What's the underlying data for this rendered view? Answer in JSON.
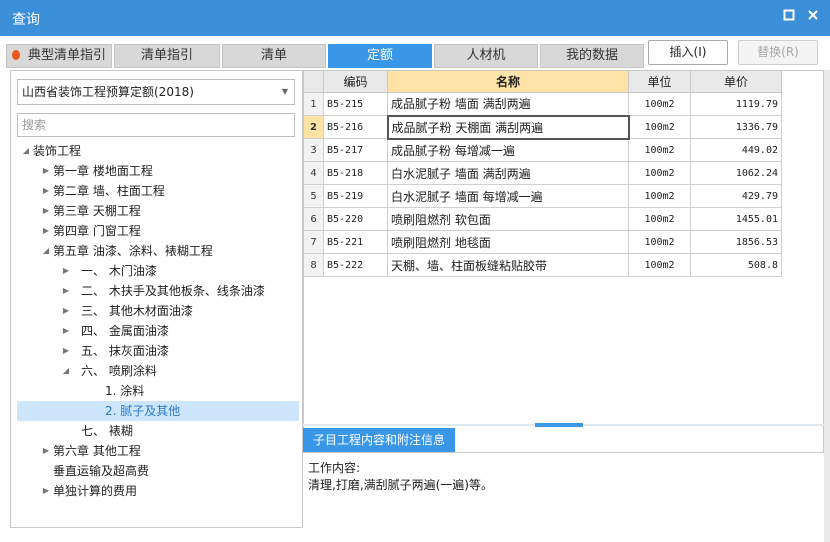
{
  "window": {
    "title": "查询"
  },
  "tabs": [
    {
      "label": "典型清单指引",
      "active": false
    },
    {
      "label": "清单指引",
      "active": false
    },
    {
      "label": "清单",
      "active": false
    },
    {
      "label": "定额",
      "active": true
    },
    {
      "label": "人材机",
      "active": false
    },
    {
      "label": "我的数据",
      "active": false
    }
  ],
  "actions": {
    "insert": "插入(I)",
    "replace": "替换(R)"
  },
  "left": {
    "dropdown_value": "山西省装饰工程预算定额(2018)",
    "search_placeholder": "搜索",
    "tree": [
      {
        "label": "装饰工程",
        "expanded": true,
        "level": 0
      },
      {
        "label": "第一章 楼地面工程",
        "expanded": false,
        "level": 1
      },
      {
        "label": "第二章 墙、柱面工程",
        "expanded": false,
        "level": 1
      },
      {
        "label": "第三章 天棚工程",
        "expanded": false,
        "level": 1
      },
      {
        "label": "第四章 门窗工程",
        "expanded": false,
        "level": 1
      },
      {
        "label": "第五章 油漆、涂料、裱糊工程",
        "expanded": true,
        "level": 1
      },
      {
        "label": "一、  木门油漆",
        "expanded": false,
        "level": 2
      },
      {
        "label": "二、  木扶手及其他板条、线条油漆",
        "expanded": false,
        "level": 2
      },
      {
        "label": "三、  其他木材面油漆",
        "expanded": false,
        "level": 2
      },
      {
        "label": "四、  金属面油漆",
        "expanded": false,
        "level": 2
      },
      {
        "label": "五、  抹灰面油漆",
        "expanded": false,
        "level": 2
      },
      {
        "label": "六、  喷刷涂料",
        "expanded": true,
        "level": 2
      },
      {
        "label": "1. 涂料",
        "level": 3
      },
      {
        "label": "2. 腻子及其他",
        "level": 3,
        "selected": true
      },
      {
        "label": "七、  裱糊",
        "level": 2
      },
      {
        "label": "第六章 其他工程",
        "expanded": false,
        "level": 1
      },
      {
        "label": "垂直运输及超高费",
        "level": 1
      },
      {
        "label": "单独计算的费用",
        "expanded": false,
        "level": 1
      }
    ]
  },
  "grid": {
    "columns": {
      "code": "编码",
      "name": "名称",
      "unit": "单位",
      "price": "单价"
    },
    "current_row": 2,
    "rows": [
      {
        "num": "1",
        "code": "B5-215",
        "name": "成品腻子粉 墙面 满刮两遍",
        "unit": "100m2",
        "price": "1119.79"
      },
      {
        "num": "2",
        "code": "B5-216",
        "name": "成品腻子粉 天棚面 满刮两遍",
        "unit": "100m2",
        "price": "1336.79"
      },
      {
        "num": "3",
        "code": "B5-217",
        "name": "成品腻子粉 每增减一遍",
        "unit": "100m2",
        "price": "449.02"
      },
      {
        "num": "4",
        "code": "B5-218",
        "name": "白水泥腻子 墙面 满刮两遍",
        "unit": "100m2",
        "price": "1062.24"
      },
      {
        "num": "5",
        "code": "B5-219",
        "name": "白水泥腻子 墙面 每增减一遍",
        "unit": "100m2",
        "price": "429.79"
      },
      {
        "num": "6",
        "code": "B5-220",
        "name": "喷刷阻燃剂 软包面",
        "unit": "100m2",
        "price": "1455.01"
      },
      {
        "num": "7",
        "code": "B5-221",
        "name": "喷刷阻燃剂 地毯面",
        "unit": "100m2",
        "price": "1856.53"
      },
      {
        "num": "8",
        "code": "B5-222",
        "name": "天棚、墙、柱面板缝粘贴胶带",
        "unit": "100m2",
        "price": "508.8"
      }
    ]
  },
  "info": {
    "tab_label": "子目工程内容和附注信息",
    "heading": "工作内容:",
    "content": "清理,打磨,满刮腻子两遍(一遍)等。"
  },
  "colors": {
    "accent": "#3a97e8",
    "titlebar": "#3c8fd9",
    "highlight": "#fde3a6",
    "selection": "#cde6fb"
  }
}
